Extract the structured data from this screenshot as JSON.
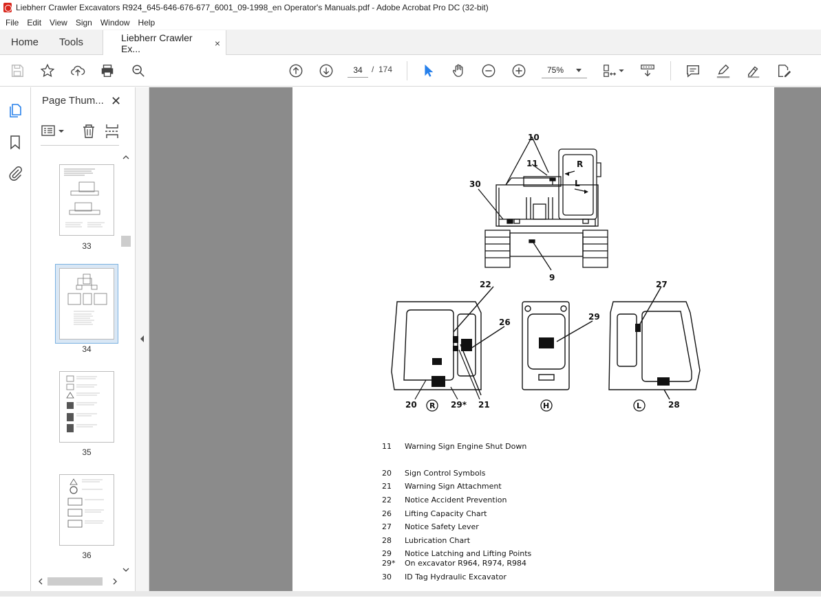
{
  "window": {
    "title": "Liebherr Crawler Excavators R924_645-646-676-677_6001_09-1998_en Operator's Manuals.pdf - Adobe Acrobat Pro DC (32-bit)"
  },
  "menu": [
    "File",
    "Edit",
    "View",
    "Sign",
    "Window",
    "Help"
  ],
  "tabs": {
    "home": "Home",
    "tools": "Tools",
    "document": "Liebherr Crawler Ex...",
    "close": "×"
  },
  "toolbar": {
    "page_current": "34",
    "page_sep": "/",
    "page_total": "174",
    "zoom": "75%",
    "icons": [
      "save-icon",
      "star-icon",
      "upload-icon",
      "print-icon",
      "zoom-search-icon",
      "prev-page-icon",
      "next-page-icon",
      "select-cursor-icon",
      "hand-icon",
      "zoom-out-icon",
      "zoom-in-icon",
      "page-fit-icon",
      "scroll-mode-icon",
      "comment-icon",
      "highlight-icon",
      "sign-icon",
      "edit-icon"
    ]
  },
  "sidebar": {
    "panel_title": "Page Thum...",
    "panel_close": "✕",
    "thumbnails": [
      {
        "page": "33",
        "selected": false
      },
      {
        "page": "34",
        "selected": true
      },
      {
        "page": "35",
        "selected": false
      },
      {
        "page": "36",
        "selected": false
      }
    ]
  },
  "document": {
    "figure_labels": {
      "top": [
        "10",
        "11",
        "30",
        "9"
      ],
      "r_view": [
        "22",
        "26",
        "20",
        "R",
        "29*",
        "21"
      ],
      "h_view": [
        "29",
        "H"
      ],
      "l_view": [
        "27",
        "L",
        "28"
      ],
      "cab_r": "R",
      "cab_l": "L"
    },
    "legend": [
      {
        "num": "11",
        "label": "Warning Sign Engine Shut Down"
      },
      {
        "num": "20",
        "label": "Sign Control Symbols"
      },
      {
        "num": "21",
        "label": "Warning Sign Attachment"
      },
      {
        "num": "22",
        "label": "Notice Accident Prevention"
      },
      {
        "num": "26",
        "label": "Lifting Capacity Chart"
      },
      {
        "num": "27",
        "label": "Notice Safety Lever"
      },
      {
        "num": "28",
        "label": "Lubrication Chart"
      },
      {
        "num": "29",
        "label": "Notice Latching and Lifting Points"
      },
      {
        "num": "29*",
        "label": "On excavator R964, R974, R984"
      },
      {
        "num": "30",
        "label": "ID Tag Hydraulic Excavator"
      }
    ]
  },
  "colors": {
    "accent": "#2680eb",
    "pdf_red": "#d9261c",
    "doc_background": "#8b8b8b"
  }
}
